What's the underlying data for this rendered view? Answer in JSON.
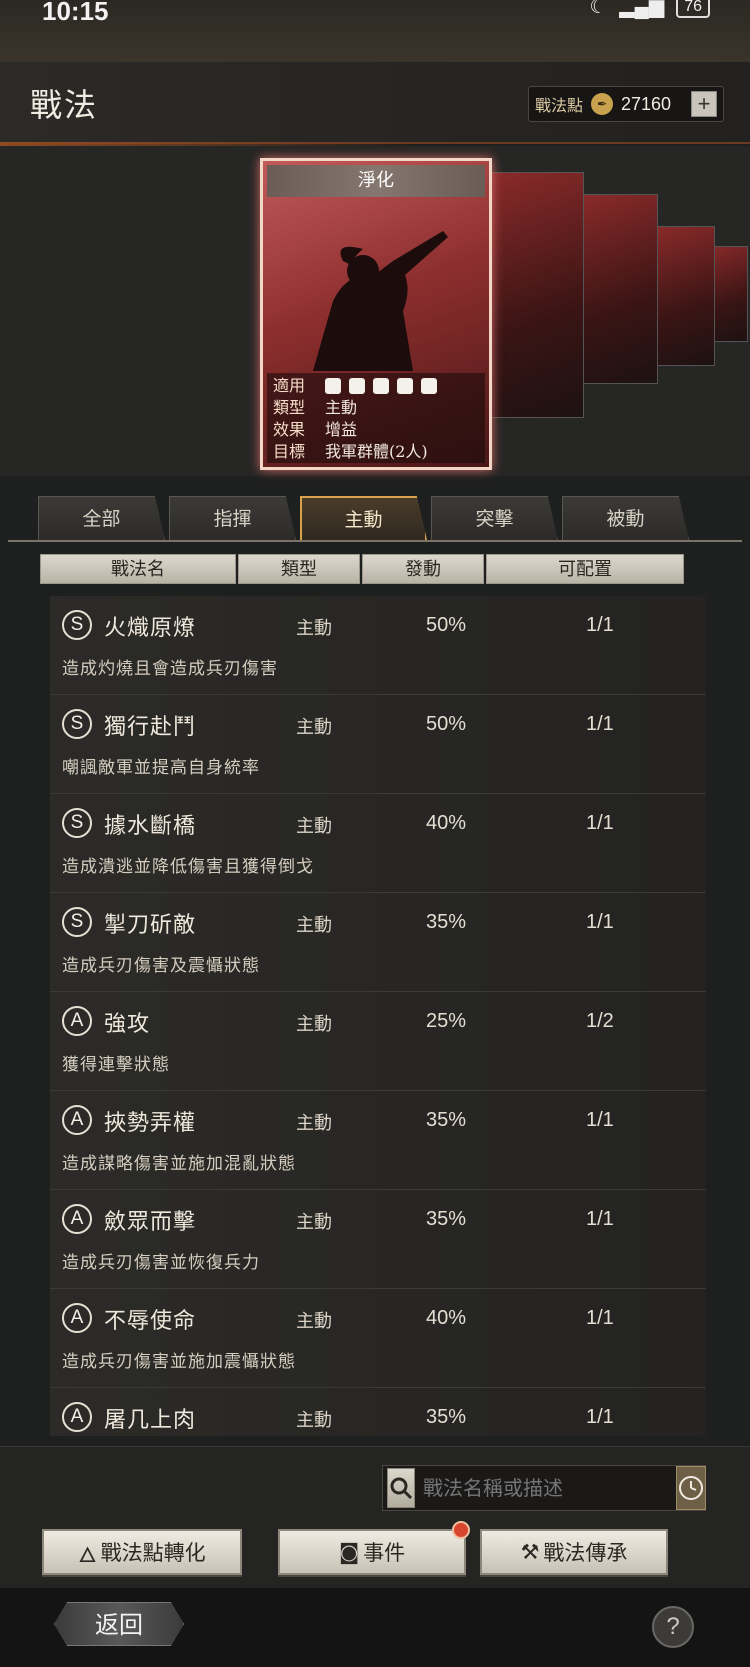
{
  "status_bar": {
    "time": "10:15",
    "battery": "76"
  },
  "header": {
    "title": "戰法",
    "points_label": "戰法點",
    "points_value": "27160",
    "add_label": "+"
  },
  "card": {
    "name": "淨化",
    "applies_label": "適用",
    "type_label": "類型",
    "type_value": "主動",
    "effect_label": "效果",
    "effect_value": "增益",
    "target_label": "目標",
    "target_value": "我軍群體(2人)"
  },
  "tabs": [
    "全部",
    "指揮",
    "主動",
    "突擊",
    "被動"
  ],
  "active_tab": "主動",
  "columns": [
    "戰法名",
    "類型",
    "發動",
    "可配置"
  ],
  "skills": [
    {
      "grade": "S",
      "name": "火熾原燎",
      "type": "主動",
      "rate": "50%",
      "config": "1/1",
      "desc": "造成灼燒且會造成兵刃傷害"
    },
    {
      "grade": "S",
      "name": "獨行赴鬥",
      "type": "主動",
      "rate": "50%",
      "config": "1/1",
      "desc": "嘲諷敵軍並提高自身統率"
    },
    {
      "grade": "S",
      "name": "據水斷橋",
      "type": "主動",
      "rate": "40%",
      "config": "1/1",
      "desc": "造成潰逃並降低傷害且獲得倒戈"
    },
    {
      "grade": "S",
      "name": "掣刀斫敵",
      "type": "主動",
      "rate": "35%",
      "config": "1/1",
      "desc": "造成兵刃傷害及震懾狀態"
    },
    {
      "grade": "A",
      "name": "強攻",
      "type": "主動",
      "rate": "25%",
      "config": "1/2",
      "desc": "獲得連擊狀態"
    },
    {
      "grade": "A",
      "name": "挾勢弄權",
      "type": "主動",
      "rate": "35%",
      "config": "1/1",
      "desc": "造成謀略傷害並施加混亂狀態"
    },
    {
      "grade": "A",
      "name": "斂眾而擊",
      "type": "主動",
      "rate": "35%",
      "config": "1/1",
      "desc": "造成兵刃傷害並恢復兵力"
    },
    {
      "grade": "A",
      "name": "不辱使命",
      "type": "主動",
      "rate": "40%",
      "config": "1/1",
      "desc": "造成兵刃傷害並施加震懾狀態"
    },
    {
      "grade": "A",
      "name": "屠几上肉",
      "type": "主動",
      "rate": "35%",
      "config": "1/1",
      "desc": ""
    }
  ],
  "search": {
    "placeholder": "戰法名稱或描述"
  },
  "actions": {
    "convert_label": "戰法點轉化",
    "event_label": "事件",
    "inherit_label": "戰法傳承"
  },
  "footer": {
    "back_label": "返回",
    "help_label": "?"
  },
  "colors": {
    "accent": "#d9a24a",
    "card_red": "#8d2e2e",
    "badge": "#d9442f"
  }
}
